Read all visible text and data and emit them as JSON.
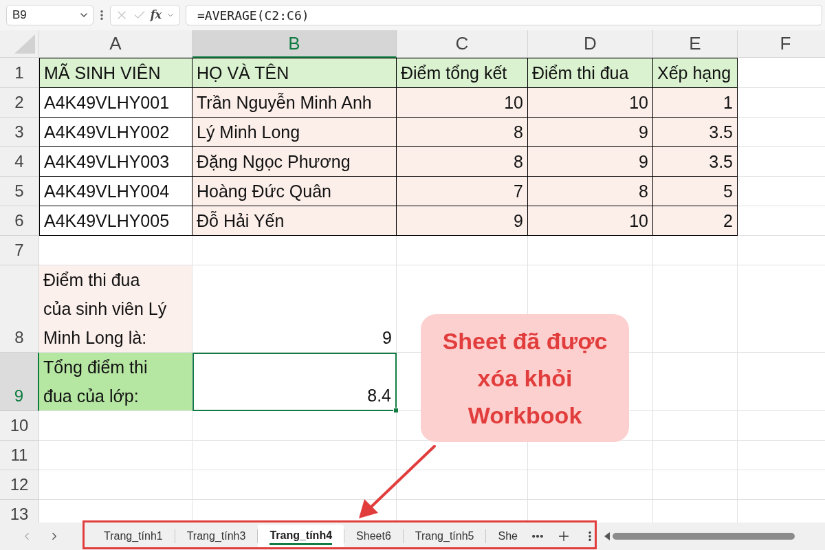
{
  "formula_bar": {
    "name_box": "B9",
    "function_label": "fx",
    "formula": "=AVERAGE(C2:C6)"
  },
  "columns": [
    {
      "label": "A",
      "selected": false
    },
    {
      "label": "B",
      "selected": true
    },
    {
      "label": "C",
      "selected": false
    },
    {
      "label": "D",
      "selected": false
    },
    {
      "label": "E",
      "selected": false
    },
    {
      "label": "F",
      "selected": false
    }
  ],
  "rows": [
    {
      "label": "1",
      "selected": false,
      "cells": [
        {
          "kind": "header",
          "text": "MÃ SINH VIÊN"
        },
        {
          "kind": "header",
          "text": "HỌ VÀ TÊN"
        },
        {
          "kind": "header",
          "text": "Điểm tổng kết"
        },
        {
          "kind": "header",
          "text": "Điểm thi đua"
        },
        {
          "kind": "header",
          "text": "Xếp hạng"
        }
      ]
    },
    {
      "label": "2",
      "selected": false,
      "cells": [
        {
          "kind": "id",
          "text": "A4K49VLHY001"
        },
        {
          "kind": "name",
          "text": "Trần Nguyễn Minh Anh"
        },
        {
          "kind": "number",
          "text": "10"
        },
        {
          "kind": "number",
          "text": "10"
        },
        {
          "kind": "number",
          "text": "1"
        }
      ]
    },
    {
      "label": "3",
      "selected": false,
      "cells": [
        {
          "kind": "id",
          "text": "A4K49VLHY002"
        },
        {
          "kind": "name",
          "text": "Lý Minh Long"
        },
        {
          "kind": "number",
          "text": "8"
        },
        {
          "kind": "number",
          "text": "9"
        },
        {
          "kind": "number",
          "text": "3.5"
        }
      ]
    },
    {
      "label": "4",
      "selected": false,
      "cells": [
        {
          "kind": "id",
          "text": "A4K49VLHY003"
        },
        {
          "kind": "name",
          "text": "Đặng Ngọc Phương"
        },
        {
          "kind": "number",
          "text": "8"
        },
        {
          "kind": "number",
          "text": "9"
        },
        {
          "kind": "number",
          "text": "3.5"
        }
      ]
    },
    {
      "label": "5",
      "selected": false,
      "cells": [
        {
          "kind": "id",
          "text": "A4K49VLHY004"
        },
        {
          "kind": "name",
          "text": "Hoàng Đức Quân"
        },
        {
          "kind": "number",
          "text": "7"
        },
        {
          "kind": "number",
          "text": "8"
        },
        {
          "kind": "number",
          "text": "5"
        }
      ]
    },
    {
      "label": "6",
      "selected": false,
      "cells": [
        {
          "kind": "id",
          "text": "A4K49VLHY005"
        },
        {
          "kind": "name",
          "text": "Đỗ Hải Yến"
        },
        {
          "kind": "number",
          "text": "9"
        },
        {
          "kind": "number",
          "text": "10"
        },
        {
          "kind": "number",
          "text": "2"
        }
      ]
    },
    {
      "label": "7",
      "selected": false
    },
    {
      "label": "8",
      "selected": false,
      "cells": [
        {
          "kind": "note",
          "text": "Điểm thi đua của sinh viên Lý Minh Long là:"
        },
        {
          "kind": "value",
          "text": "9"
        }
      ]
    },
    {
      "label": "9",
      "selected": true,
      "cells": [
        {
          "kind": "total_label",
          "text": "Tổng điểm thi đua của lớp:"
        },
        {
          "kind": "value",
          "text": "8.4"
        }
      ]
    },
    {
      "label": "10",
      "selected": false
    },
    {
      "label": "11",
      "selected": false
    },
    {
      "label": "12",
      "selected": false
    },
    {
      "label": "13",
      "selected": false
    }
  ],
  "sheet_tabs": [
    {
      "label": "Trang_tính1",
      "selected": false
    },
    {
      "label": "Trang_tính3",
      "selected": false
    },
    {
      "label": "Trang_tính4",
      "selected": true
    },
    {
      "label": "Sheet6",
      "selected": false
    },
    {
      "label": "Trang_tính5",
      "selected": false
    },
    {
      "label": "She",
      "selected": false
    }
  ],
  "callout": {
    "text": "Sheet đã được xóa khỏi Workbook"
  }
}
